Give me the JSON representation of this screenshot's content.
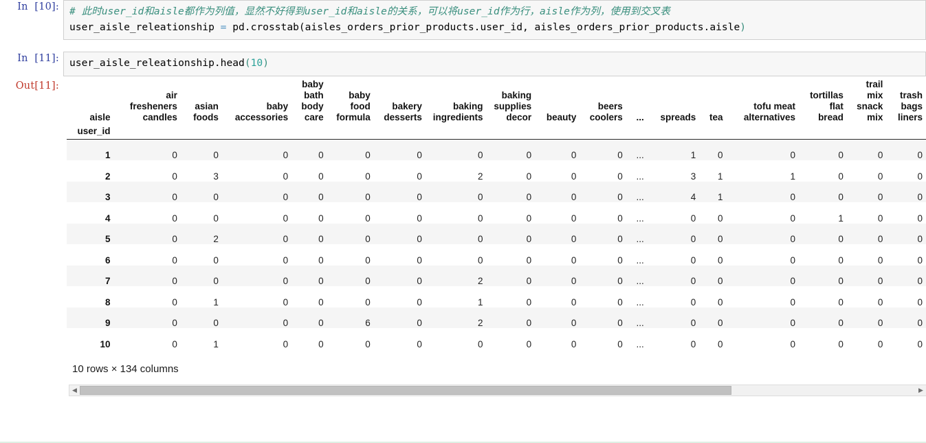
{
  "cells": [
    {
      "prompt": "In  [10]:",
      "comment": "# 此时user_id和aisle都作为列值，显然不好得到user_id和aisle的关系，可以将user_id作为行，aisle作为列，使用到交叉表",
      "code_var": "user_aisle_releationship ",
      "code_eq": "=",
      "code_rest": " pd.crosstab(aisles_orders_prior_products.user_id, aisles_orders_prior_products.aisle",
      "code_close": ")"
    },
    {
      "prompt": "In  [11]:",
      "code_expr": "user_aisle_releationship.head",
      "code_open": "(",
      "code_arg": "10",
      "code_close": ")"
    }
  ],
  "output": {
    "prompt": "Out[11]:",
    "index_name": "user_id",
    "first_header": "aisle",
    "columns": [
      "air fresheners candles",
      "asian foods",
      "baby accessories",
      "baby bath body care",
      "baby food formula",
      "bakery desserts",
      "baking ingredients",
      "baking supplies decor",
      "beauty",
      "beers coolers",
      "...",
      "spreads",
      "tea",
      "tofu meat alternatives",
      "tortillas flat bread",
      "trail mix snack mix",
      "trash bags liners"
    ],
    "index_values": [
      "1",
      "2",
      "3",
      "4",
      "5",
      "6",
      "7",
      "8",
      "9",
      "10"
    ],
    "rows": [
      [
        "0",
        "0",
        "0",
        "0",
        "0",
        "0",
        "0",
        "0",
        "0",
        "0",
        "...",
        "1",
        "0",
        "0",
        "0",
        "0",
        "0"
      ],
      [
        "0",
        "3",
        "0",
        "0",
        "0",
        "0",
        "2",
        "0",
        "0",
        "0",
        "...",
        "3",
        "1",
        "1",
        "0",
        "0",
        "0"
      ],
      [
        "0",
        "0",
        "0",
        "0",
        "0",
        "0",
        "0",
        "0",
        "0",
        "0",
        "...",
        "4",
        "1",
        "0",
        "0",
        "0",
        "0"
      ],
      [
        "0",
        "0",
        "0",
        "0",
        "0",
        "0",
        "0",
        "0",
        "0",
        "0",
        "...",
        "0",
        "0",
        "0",
        "1",
        "0",
        "0"
      ],
      [
        "0",
        "2",
        "0",
        "0",
        "0",
        "0",
        "0",
        "0",
        "0",
        "0",
        "...",
        "0",
        "0",
        "0",
        "0",
        "0",
        "0"
      ],
      [
        "0",
        "0",
        "0",
        "0",
        "0",
        "0",
        "0",
        "0",
        "0",
        "0",
        "...",
        "0",
        "0",
        "0",
        "0",
        "0",
        "0"
      ],
      [
        "0",
        "0",
        "0",
        "0",
        "0",
        "0",
        "2",
        "0",
        "0",
        "0",
        "...",
        "0",
        "0",
        "0",
        "0",
        "0",
        "0"
      ],
      [
        "0",
        "1",
        "0",
        "0",
        "0",
        "0",
        "1",
        "0",
        "0",
        "0",
        "...",
        "0",
        "0",
        "0",
        "0",
        "0",
        "0"
      ],
      [
        "0",
        "0",
        "0",
        "0",
        "6",
        "0",
        "2",
        "0",
        "0",
        "0",
        "...",
        "0",
        "0",
        "0",
        "0",
        "0",
        "0"
      ],
      [
        "0",
        "1",
        "0",
        "0",
        "0",
        "0",
        "0",
        "0",
        "0",
        "0",
        "...",
        "0",
        "0",
        "0",
        "0",
        "0",
        "0"
      ]
    ],
    "shape_text": "10 rows × 134 columns"
  },
  "scrollbar": {
    "left_arrow": "◀",
    "right_arrow": "▶",
    "thumb_percent": 78
  },
  "colors": {
    "prompt_in": "#303f9f",
    "prompt_out": "#c0392b",
    "comment": "#3a8f7e",
    "cell_bg": "#f7f7f7",
    "row_alt": "#f5f5f5"
  }
}
